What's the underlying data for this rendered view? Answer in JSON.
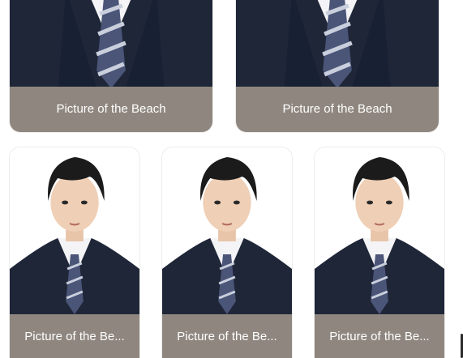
{
  "gallery": {
    "cards": [
      {
        "caption": "Picture of the Beach",
        "image_alt": "portrait-photo"
      },
      {
        "caption": "Picture of the Beach",
        "image_alt": "portrait-photo"
      },
      {
        "caption": "Picture of the Be...",
        "image_alt": "portrait-photo"
      },
      {
        "caption": "Picture of the Be...",
        "image_alt": "portrait-photo"
      },
      {
        "caption": "Picture of the Be...",
        "image_alt": "portrait-photo"
      }
    ]
  },
  "colors": {
    "caption_bg": "#8f877f",
    "caption_text": "#ffffff",
    "suit": "#1f2638",
    "tie": "#4a5578"
  }
}
